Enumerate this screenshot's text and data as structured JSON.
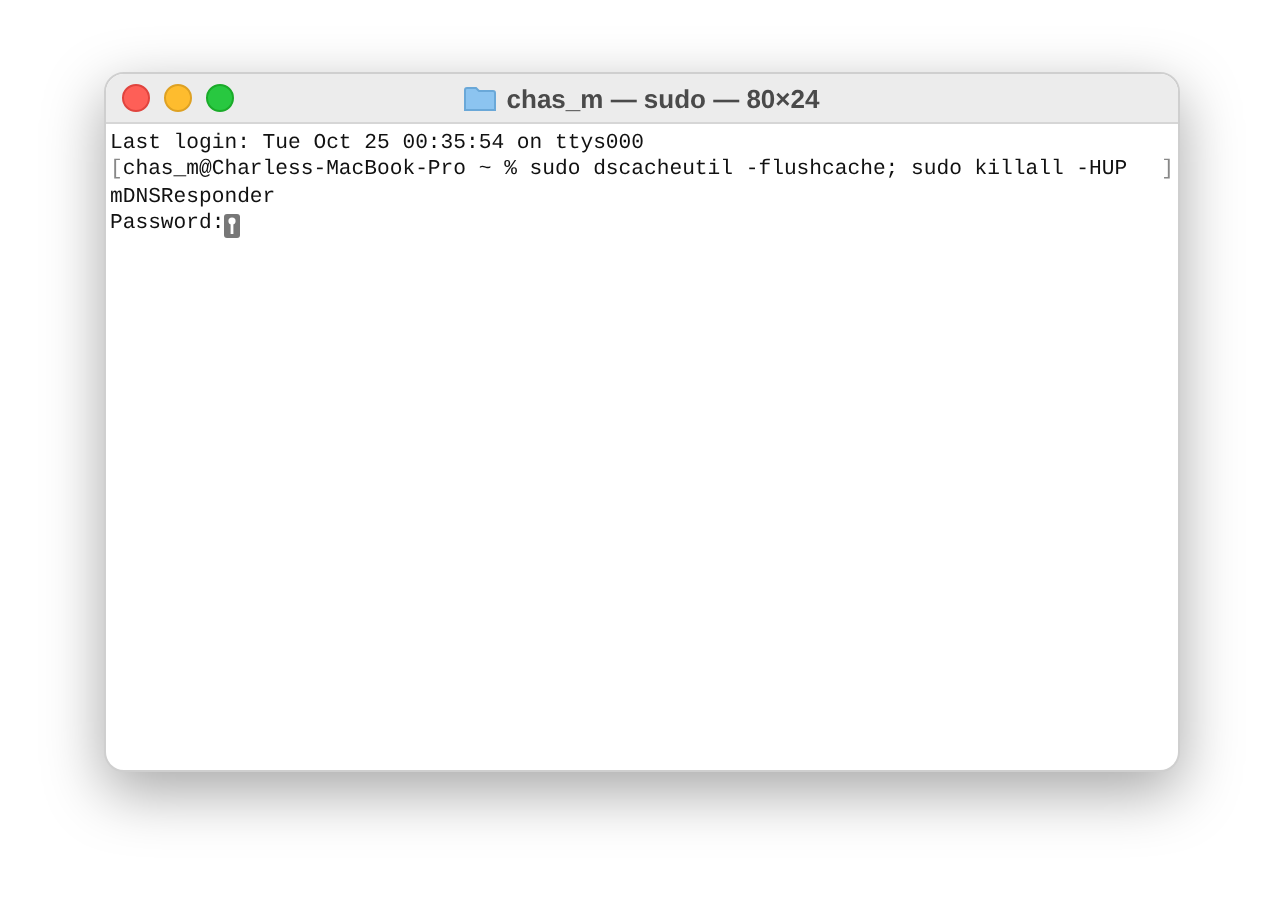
{
  "window": {
    "title": "chas_m — sudo — 80×24"
  },
  "terminal": {
    "lines": [
      {
        "text": "Last login: Tue Oct 25 00:35:54 on ttys000"
      },
      {
        "text": "chas_m@Charless-MacBook-Pro ~ % sudo dscacheutil -flushcache; sudo killall -HUP",
        "mark_start": "[",
        "mark_end": "]"
      },
      {
        "text": "mDNSResponder"
      },
      {
        "text": "Password:",
        "cursor": true
      }
    ]
  }
}
